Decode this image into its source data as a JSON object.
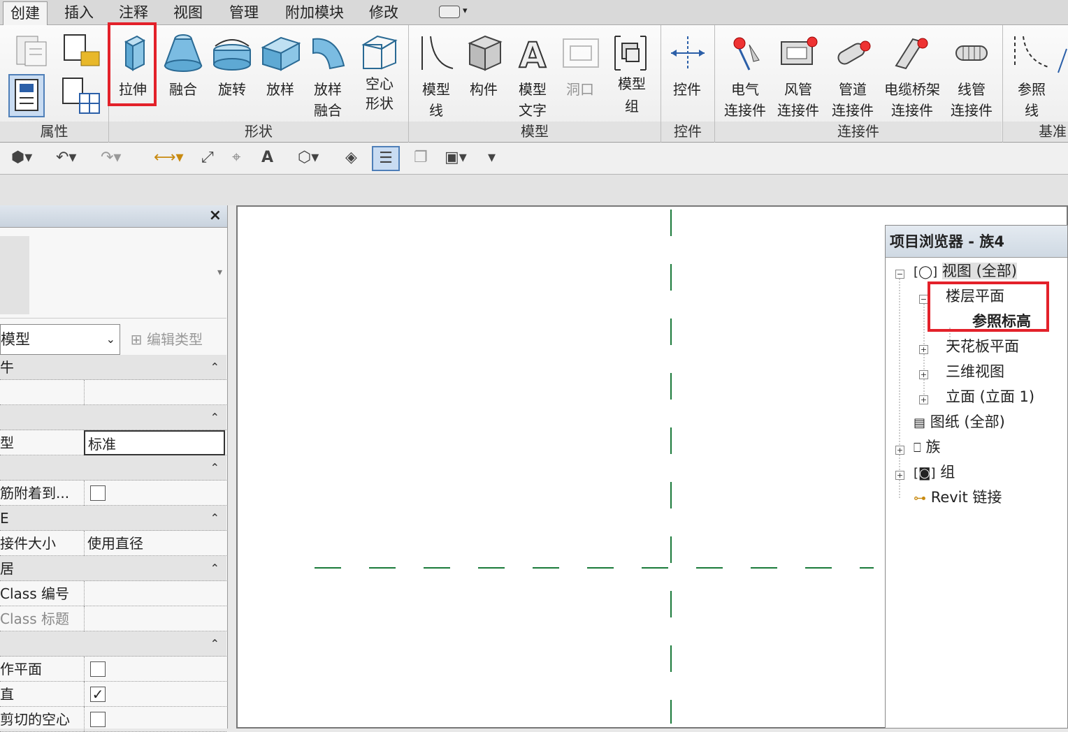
{
  "tabs": [
    "创建",
    "插入",
    "注释",
    "视图",
    "管理",
    "附加模块",
    "修改"
  ],
  "ribbon": {
    "groups": [
      "属性",
      "形状",
      "模型",
      "控件",
      "连接件",
      "基准"
    ],
    "shape_tools": [
      {
        "label": "拉伸",
        "icon": "extrusion-icon"
      },
      {
        "label": "融合",
        "icon": "blend-icon"
      },
      {
        "label": "旋转",
        "icon": "revolve-icon"
      },
      {
        "label": "放样",
        "icon": "sweep-icon"
      },
      {
        "label1": "放样",
        "label2": "融合",
        "icon": "swept-blend-icon"
      },
      {
        "label1": "空心",
        "label2": "形状",
        "icon": "void-forms-icon"
      }
    ],
    "model_tools": [
      {
        "label1": "模型",
        "label2": "线",
        "icon": "model-line-icon"
      },
      {
        "label": "构件",
        "icon": "component-icon"
      },
      {
        "label1": "模型",
        "label2": "文字",
        "icon": "model-text-icon"
      },
      {
        "label": "洞口",
        "icon": "opening-icon"
      },
      {
        "label1": "模型",
        "label2": "组",
        "icon": "model-group-icon"
      }
    ],
    "control_tool": {
      "label": "控件",
      "icon": "control-icon"
    },
    "connector_tools": [
      {
        "label1": "电气",
        "label2": "连接件",
        "icon": "electrical-connector-icon"
      },
      {
        "label1": "风管",
        "label2": "连接件",
        "icon": "duct-connector-icon"
      },
      {
        "label1": "管道",
        "label2": "连接件",
        "icon": "pipe-connector-icon"
      },
      {
        "label1": "电缆桥架",
        "label2": "连接件",
        "icon": "cable-tray-connector-icon"
      },
      {
        "label1": "线管",
        "label2": "连接件",
        "icon": "conduit-connector-icon"
      }
    ],
    "datum_tool": {
      "label1": "参照",
      "label2": "线",
      "icon": "reference-line-icon"
    }
  },
  "properties": {
    "type_selector": "模型",
    "edit_type": "编辑类型",
    "rows": [
      {
        "section": true,
        "k": "牛"
      },
      {
        "k": "",
        "v": ""
      },
      {
        "section": true,
        "k": ""
      },
      {
        "k": "型",
        "v": "标准"
      },
      {
        "section": true,
        "k": ""
      },
      {
        "k": "筋附着到...",
        "checkbox": false
      },
      {
        "section": true,
        "k": "E"
      },
      {
        "k": "接件大小",
        "v": "使用直径"
      },
      {
        "section": true,
        "k": "居"
      },
      {
        "k": "Class 编号",
        "v": ""
      },
      {
        "k": "Class 标题",
        "v": ""
      },
      {
        "section": true,
        "k": ""
      },
      {
        "k": "作平面",
        "checkbox": false
      },
      {
        "k": "直",
        "checkbox": true
      },
      {
        "k": "剪切的空心",
        "checkbox": false
      }
    ]
  },
  "browser": {
    "title": "项目浏览器 - 族4",
    "nodes": {
      "views": "视图 (全部)",
      "floor_plans": "楼层平面",
      "ref_level": "参照标高",
      "ceiling_plans": "天花板平面",
      "threed": "三维视图",
      "elevations": "立面 (立面 1)",
      "sheets": "图纸 (全部)",
      "families": "族",
      "groups": "组",
      "revit_links": "Revit 链接"
    }
  },
  "colors": {
    "highlight": "#e3212a",
    "refplane": "#1a7a3a"
  }
}
